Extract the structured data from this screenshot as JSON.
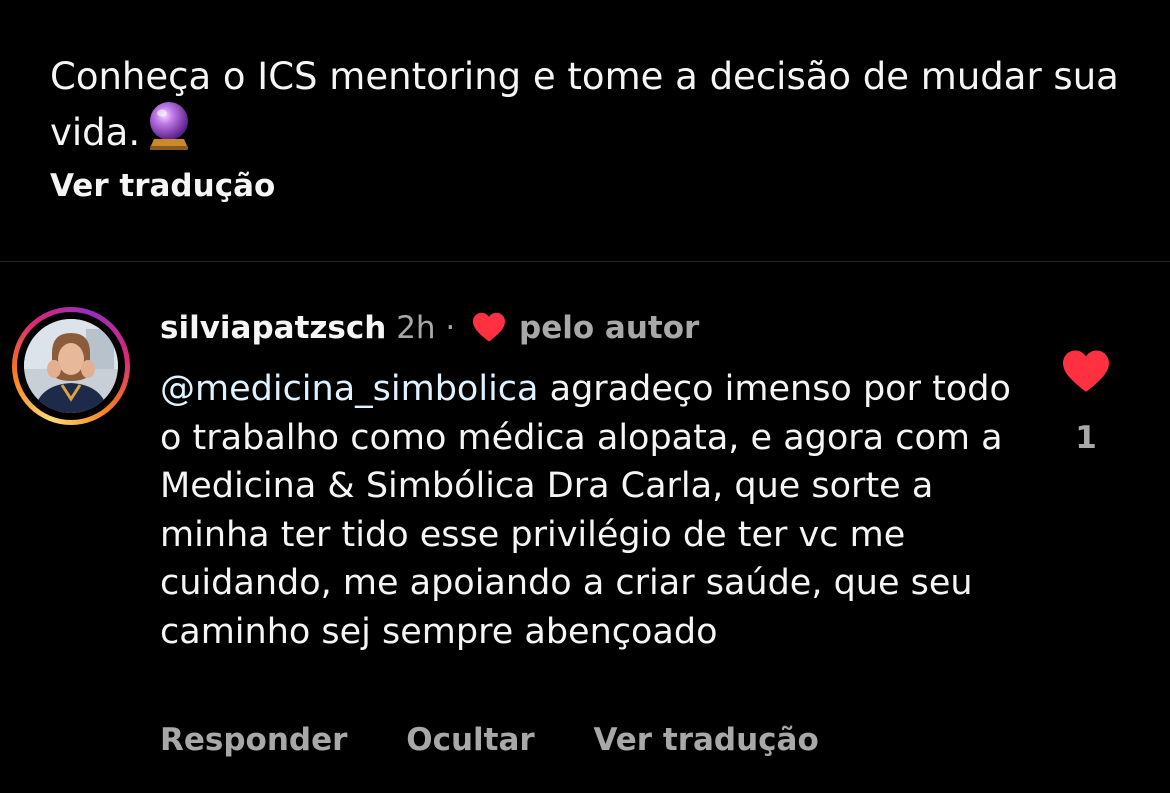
{
  "post": {
    "caption": "Conheça o ICS mentoring e tome a decisão de mudar sua vida.",
    "caption_emoji": "crystal-ball-icon",
    "translate_label": "Ver tradução"
  },
  "comment": {
    "username": "silviapatzsch",
    "time": "2h",
    "separator": "·",
    "liked_by_author_label": "pelo autor",
    "mention": "@medicina_simbolica",
    "text": " agradeço imenso por todo o trabalho como médica alopata, e agora com a Medicina & Simbólica  Dra Carla, que sorte a minha ter tido esse privilégio de ter vc me cuidando, me apoiando a criar saúde, que seu caminho sej sempre abençoado",
    "like_count": "1",
    "liked": true,
    "actions": {
      "reply": "Responder",
      "hide": "Ocultar",
      "translate": "Ver tradução"
    }
  },
  "colors": {
    "background": "#000000",
    "text_primary": "#f5f5f5",
    "text_secondary": "#a8a8a8",
    "heart": "#ff3040",
    "mention": "#e0f1ff",
    "divider": "#262626"
  }
}
